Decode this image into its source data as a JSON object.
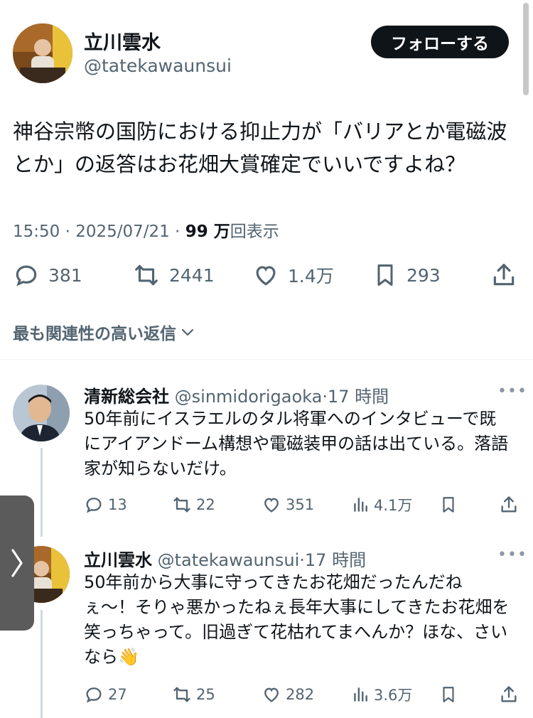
{
  "main_tweet": {
    "author_name": "立川雲水",
    "author_handle": "@tatekawaunsui",
    "follow_label": "フォローする",
    "text": "神谷宗幣の国防における抑止力が「バリアとか電磁波とか」の返答はお花畑大賞確定でいいですよね？",
    "time": "15:50",
    "date": "2025/07/21",
    "views_count": "99 万",
    "views_label": "回表示",
    "replies": "381",
    "retweets": "2441",
    "likes": "1.4万",
    "bookmarks": "293"
  },
  "sort_label": "最も関連性の高い返信",
  "replies": [
    {
      "name": "清新総会社",
      "handle": "@sinmidorigaoka",
      "time": "17 時間",
      "text": "50年前にイスラエルのタル将軍へのインタビューで既にアイアンドーム構想や電磁装甲の話は出ている。落語家が知らないだけ。",
      "replies": "13",
      "retweets": "22",
      "likes": "351",
      "views": "4.1万"
    },
    {
      "name": "立川雲水",
      "handle": "@tatekawaunsui",
      "time": "17 時間",
      "text": "50年前から大事に守ってきたお花畑だったんだねぇ〜！そりゃ悪かったねぇ長年大事にしてきたお花畑を笑っちゃって。旧過ぎて花枯れてまへんか？ほな、さいなら👋",
      "replies": "27",
      "retweets": "25",
      "likes": "282",
      "views": "3.6万"
    }
  ],
  "icons": {
    "reply": "reply-icon",
    "retweet": "retweet-icon",
    "like": "heart-icon",
    "views": "views-icon",
    "bookmark": "bookmark-icon",
    "share": "share-icon"
  },
  "colors": {
    "text": "#0f1419",
    "secondary": "#536471",
    "follow_bg": "#0f1419"
  }
}
